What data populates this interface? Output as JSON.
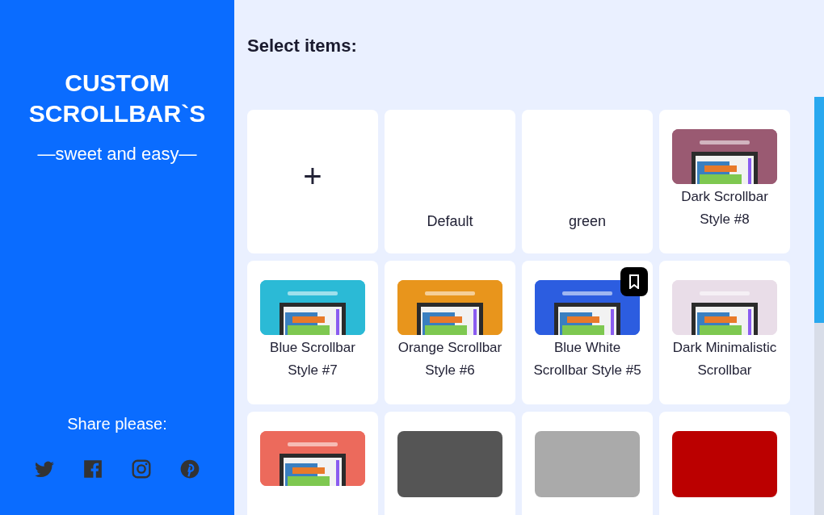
{
  "sidebar": {
    "title": "CUSTOM SCROLLBAR`S",
    "tagline": "—sweet and easy—",
    "share_label": "Share please:",
    "share_icons": [
      {
        "kind": "twitter"
      },
      {
        "kind": "facebook"
      },
      {
        "kind": "instagram"
      },
      {
        "kind": "pinterest"
      }
    ]
  },
  "heading": "Select items:",
  "items": [
    {
      "kind": "add",
      "label": "+"
    },
    {
      "kind": "text",
      "label": "Default"
    },
    {
      "kind": "text",
      "label": "green"
    },
    {
      "kind": "picture",
      "color": "#9a5a72",
      "label": "Dark Scrollbar Style #8",
      "bookmarked": false
    },
    {
      "kind": "picture",
      "color": "#2bbad6",
      "label": "Blue Scrollbar Style #7",
      "bookmarked": false
    },
    {
      "kind": "picture",
      "color": "#e8951c",
      "label": "Orange Scrollbar Style #6",
      "bookmarked": false
    },
    {
      "kind": "picture",
      "color": "#2c5de0",
      "label": "Blue White Scrollbar Style #5",
      "bookmarked": true
    },
    {
      "kind": "picture",
      "color": "#e9dde8",
      "label": "Dark Minimalistic Scrollbar",
      "bookmarked": false
    },
    {
      "kind": "picture",
      "color": "#ec6a5c",
      "bookmarked": false
    },
    {
      "kind": "color",
      "color": "#555555"
    },
    {
      "kind": "color",
      "color": "#aaaaaa"
    },
    {
      "kind": "color",
      "color": "#bb0000"
    }
  ]
}
